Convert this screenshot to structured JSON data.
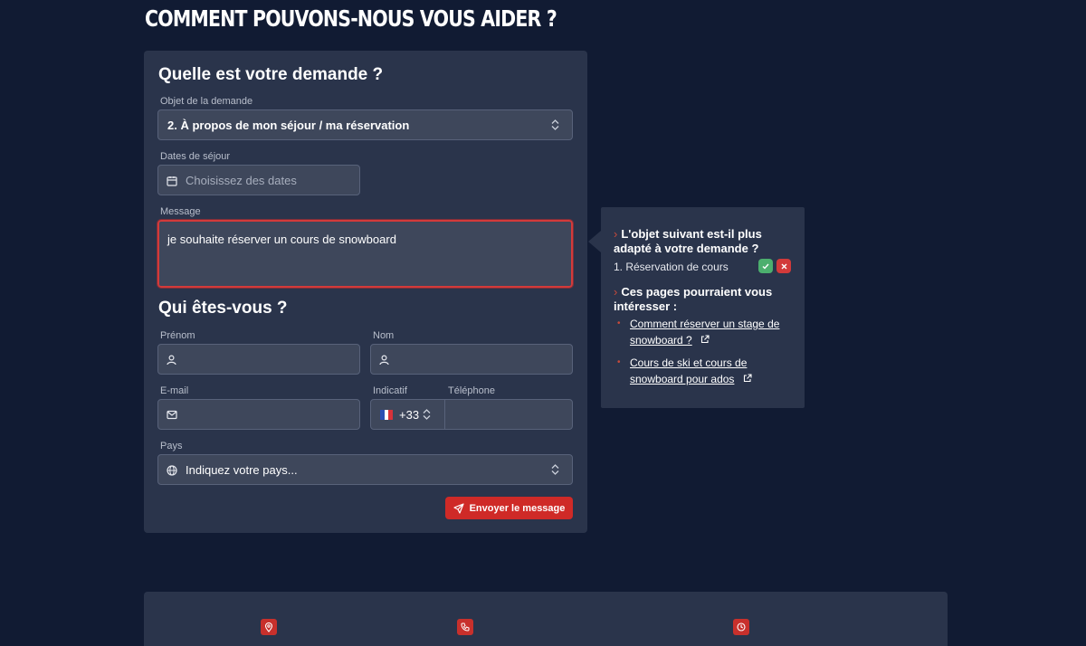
{
  "page": {
    "title": "COMMENT POUVONS-NOUS VOUS AIDER ?"
  },
  "request": {
    "title": "Quelle est votre demande ?",
    "subject": {
      "label": "Objet de la demande",
      "value": "2. À propos de mon séjour / ma réservation"
    },
    "dates": {
      "label": "Dates de séjour",
      "placeholder": "Choisissez des dates"
    },
    "message": {
      "label": "Message",
      "value": "je souhaite réserver un cours de snowboard"
    }
  },
  "identity": {
    "title": "Qui êtes-vous ?",
    "first_name": {
      "label": "Prénom",
      "value": ""
    },
    "last_name": {
      "label": "Nom",
      "value": ""
    },
    "email": {
      "label": "E-mail",
      "value": ""
    },
    "dial_code": {
      "label": "Indicatif",
      "value": "+33"
    },
    "phone": {
      "label": "Téléphone",
      "value": ""
    },
    "country": {
      "label": "Pays",
      "placeholder": "Indiquez votre pays..."
    }
  },
  "send_label": "Envoyer le message",
  "suggestion": {
    "question_line1": "L'objet suivant est-il plus",
    "question_line2": "adapté à votre demande ?",
    "item": "1. Réservation de cours",
    "pages_line1": "Ces pages pourraient vous",
    "pages_line2": "intéresser :",
    "links": [
      {
        "line1": "Comment réserver un stage de",
        "line2": "snowboard ?"
      },
      {
        "line1": "Cours de ski et cours de",
        "line2": "snowboard pour ados"
      }
    ]
  },
  "colors": {
    "background": "#111b33",
    "card": "#2a344b",
    "accent": "#cf2a27",
    "field": "#3e475b",
    "confirm": "#4caf6e"
  },
  "icons": [
    "calendar-icon",
    "user-icon",
    "mail-icon",
    "globe-icon",
    "send-icon",
    "external-link-icon",
    "map-pin-icon",
    "phone-icon",
    "clock-icon",
    "check-icon",
    "close-icon",
    "chevron-updown-icon",
    "flag-fr-icon"
  ]
}
